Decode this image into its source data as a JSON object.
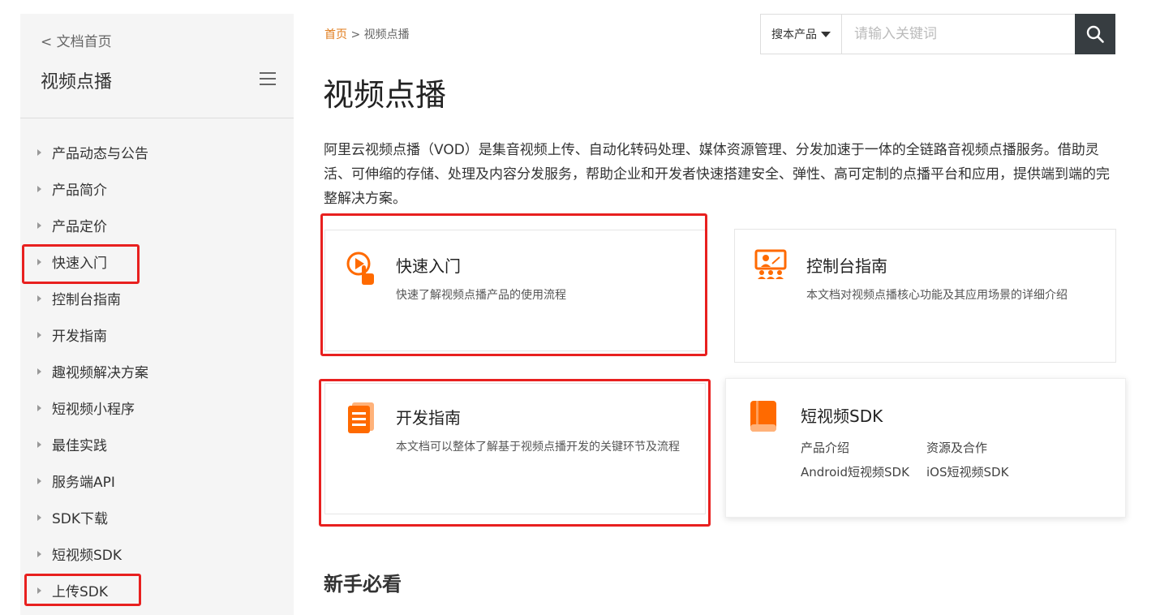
{
  "sidebar": {
    "back_label": "< 文档首页",
    "title": "视频点播",
    "items": [
      {
        "label": "产品动态与公告"
      },
      {
        "label": "产品简介"
      },
      {
        "label": "产品定价"
      },
      {
        "label": "快速入门"
      },
      {
        "label": "控制台指南"
      },
      {
        "label": "开发指南"
      },
      {
        "label": "趣视频解决方案"
      },
      {
        "label": "短视频小程序"
      },
      {
        "label": "最佳实践"
      },
      {
        "label": "服务端API"
      },
      {
        "label": "SDK下载"
      },
      {
        "label": "短视频SDK"
      },
      {
        "label": "上传SDK"
      }
    ]
  },
  "breadcrumb": {
    "home": "首页",
    "separator": " > ",
    "current": "视频点播"
  },
  "search": {
    "scope": "搜本产品",
    "placeholder": "请输入关键词"
  },
  "main": {
    "title": "视频点播",
    "description": "阿里云视频点播（VOD）是集音视频上传、自动化转码处理、媒体资源管理、分发加速于一体的全链路音视频点播服务。借助灵活、可伸缩的存储、处理及内容分发服务，帮助企业和开发者快速搭建安全、弹性、高可定制的点播平台和应用，提供端到端的完整解决方案。",
    "section_heading": "新手必看"
  },
  "cards": {
    "quickstart": {
      "title": "快速入门",
      "text": "快速了解视频点播产品的使用流程"
    },
    "console": {
      "title": "控制台指南",
      "text": "本文档对视频点播核心功能及其应用场景的详细介绍"
    },
    "devguide": {
      "title": "开发指南",
      "text": "本文档可以整体了解基于视频点播开发的关键环节及流程"
    },
    "shortvideo": {
      "title": "短视频SDK",
      "links": [
        "产品介绍",
        "资源及合作",
        "Android短视频SDK",
        "iOS短视频SDK"
      ]
    }
  },
  "colors": {
    "accent": "#ff6a00",
    "annotation": "#e8201f",
    "search_button": "#373d41"
  }
}
